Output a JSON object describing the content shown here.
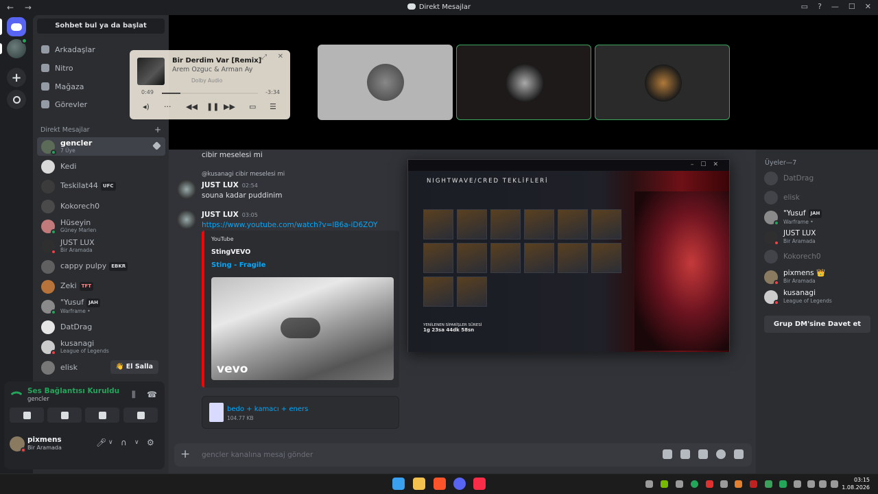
{
  "titlebar": {
    "nav": "← →",
    "title": "Direkt Mesajlar"
  },
  "sidebar": {
    "search": "Sohbet bul ya da başlat",
    "nav": [
      {
        "label": "Arkadaşlar"
      },
      {
        "label": "Nitro"
      },
      {
        "label": "Mağaza"
      },
      {
        "label": "Görevler"
      }
    ],
    "dm_header": "Direkt Mesajlar",
    "dm_plus": "+",
    "dms": [
      {
        "name": "gencler",
        "sub": "7 Üye",
        "status": "none"
      },
      {
        "name": "Kedi",
        "sub": "",
        "status": "none"
      },
      {
        "name": "Teskilat44",
        "sub": "",
        "tag": "UFC",
        "status": "none"
      },
      {
        "name": "Kokorech0",
        "sub": "",
        "status": "none"
      },
      {
        "name": "Hüseyin",
        "sub": "Güney Marlen",
        "status": "on"
      },
      {
        "name": "JUST LUX",
        "sub": "Bir Aramada",
        "status": "dnd"
      },
      {
        "name": "cappy pulpy",
        "sub": "",
        "tag": "EBKR",
        "status": "none"
      },
      {
        "name": "Zeki",
        "sub": "",
        "tag": "TFT",
        "status": "none"
      },
      {
        "name": "\"Yusuf",
        "sub": "Warframe •",
        "tag": "JAH",
        "status": "on"
      },
      {
        "name": "DatDrag",
        "sub": "",
        "status": "none"
      },
      {
        "name": "kusanagi",
        "sub": "League of Legends",
        "status": "dnd"
      },
      {
        "name": "elisk",
        "sub": "",
        "status": "none"
      }
    ],
    "wave_label": "👋 El Salla"
  },
  "voice": {
    "title": "Ses Bağlantısı Kuruldu",
    "channel": "gencler"
  },
  "user": {
    "name": "pixmens",
    "status": "Bir Aramada"
  },
  "player": {
    "title": "Bir Derdim Var [Remix]",
    "artist": "Arem Ozguc & Arman Aydin",
    "dolby": "Dolby Audio",
    "elapsed": "0:49",
    "remaining": "-3:34",
    "progress": 0.19
  },
  "chat": {
    "m0": "cibir meselesi mi",
    "reply_user": "@kusanagi",
    "reply_text": "cibir meselesi mi",
    "m1_name": "JUST LUX",
    "m1_time": "02:54",
    "m1_text": "souna kadar puddinim",
    "m2_name": "JUST LUX",
    "m2_time": "03:05",
    "m2_link": "https://www.youtube.com/watch?v=lB6a-iD6ZOY",
    "embed": {
      "provider": "YouTube",
      "channel": "StingVEVO",
      "title": "Sting - Fragile",
      "logo": "vevo"
    },
    "file": {
      "name": "bedo + kamacı + eners",
      "size": "104.77 KB"
    },
    "input_placeholder": "gencler kanalına mesaj gönder"
  },
  "popout": {
    "game_title": "NIGHTWAVE/CRED TEKLİFLERİ",
    "timer_label": "YENİLENEN SİPARİŞLER SÜRESİ",
    "timer": "1g 23sa 44dk 58sn"
  },
  "members": {
    "header": "Üyeler—7",
    "list": [
      {
        "name": "DatDrag",
        "sub": "",
        "dim": true
      },
      {
        "name": "elisk",
        "sub": "",
        "dim": true
      },
      {
        "name": "\"Yusuf",
        "sub": "Warframe •",
        "tag": "JAH",
        "dim": false
      },
      {
        "name": "JUST LUX",
        "sub": "Bir Aramada",
        "dim": false
      },
      {
        "name": "Kokorech0",
        "sub": "",
        "dim": true
      },
      {
        "name": "pixmens",
        "sub": "Bir Aramada",
        "crown": "👑",
        "dim": false
      },
      {
        "name": "kusanagi",
        "sub": "League of Legends",
        "dim": false
      }
    ],
    "invite": "Grup DM'sine Davet et"
  },
  "clock": {
    "time": "03:15",
    "date": "1.08.2026"
  }
}
